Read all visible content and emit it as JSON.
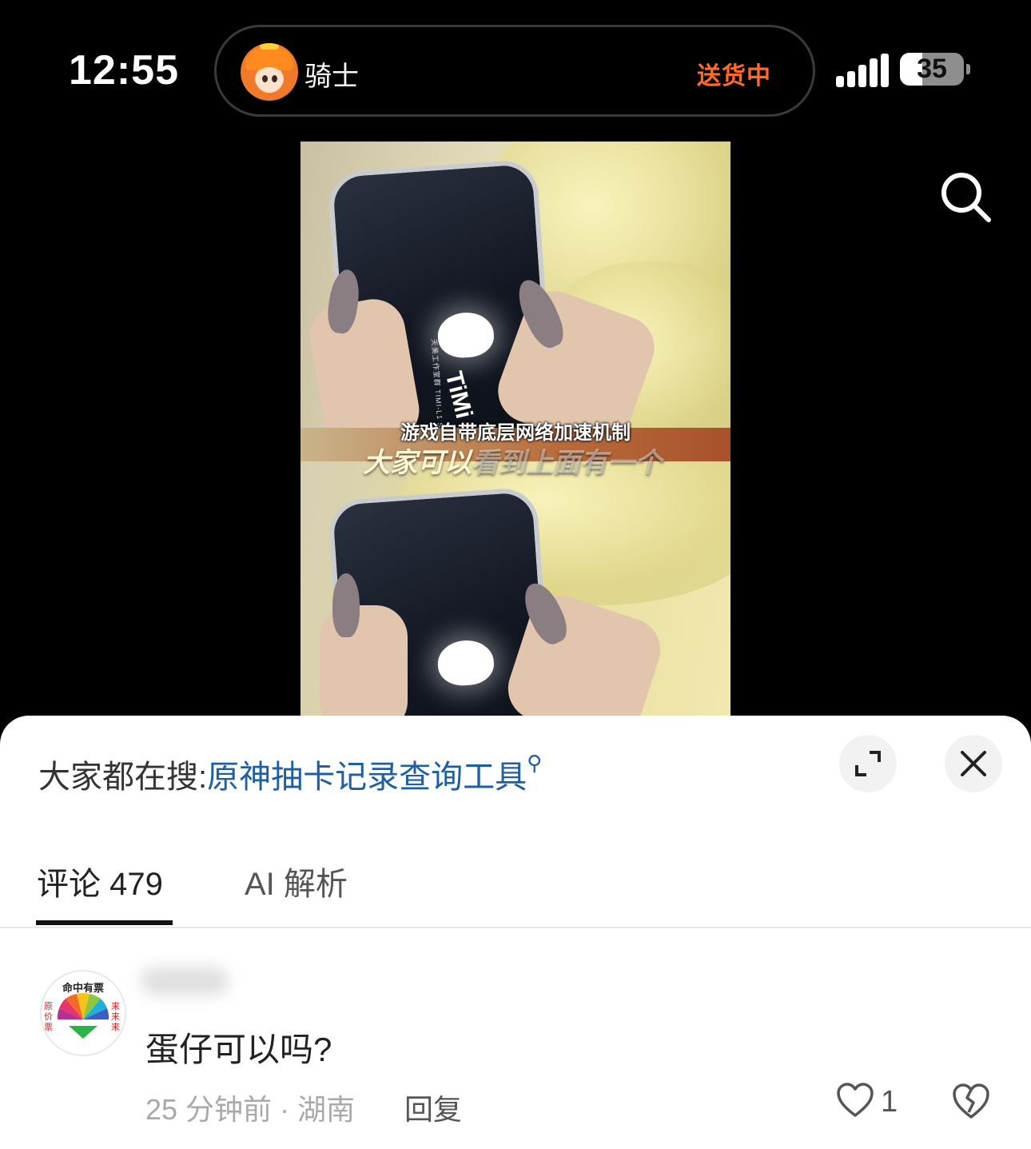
{
  "status_bar": {
    "time": "12:55",
    "live_activity": {
      "rider_label": "骑士",
      "delivery_status": "送货中"
    },
    "battery_percent": "35",
    "battery_level": 0.35,
    "signal_icon": "signal-bars-icon"
  },
  "video": {
    "caption_small": "游戏自带底层网络加速机制",
    "caption_big_highlight": "大家可以",
    "caption_big_rest": "看到上面有一个",
    "timi_logo": "TiMi",
    "studio_text": "天美工作室群 TIMI-L1 STUDIO"
  },
  "sheet": {
    "trending_label": "大家都在搜:",
    "trending_term": "原神抽卡记录查询工具",
    "tabs": [
      {
        "label": "评论 479",
        "active": true
      },
      {
        "label": "AI 解析",
        "active": false
      }
    ],
    "comment": {
      "avatar_text_top": "命中有票",
      "avatar_text_left": "原价票",
      "avatar_text_right": "来来来",
      "text": "蛋仔可以吗?",
      "meta": "25 分钟前 · 湖南",
      "reply_label": "回复",
      "like_count": "1"
    }
  },
  "colors": {
    "accent_orange": "#ff6a2b",
    "link_blue": "#1f5fa0"
  }
}
